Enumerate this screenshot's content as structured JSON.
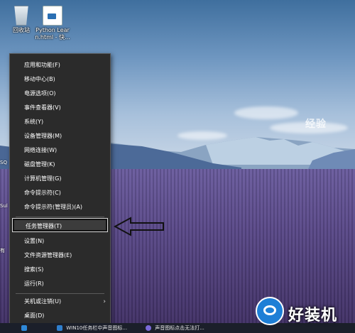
{
  "desktop": {
    "icons": [
      {
        "label": "回收站",
        "icon": "recycle-bin-icon"
      },
      {
        "label": "Python Lear n.html - 快...",
        "icon": "html-document-icon"
      }
    ],
    "left_edge_labels": [
      "SQ",
      "Sul",
      "有"
    ]
  },
  "context_menu": {
    "items": [
      {
        "label": "应用和功能(F)"
      },
      {
        "label": "移动中心(B)"
      },
      {
        "label": "电源选项(O)"
      },
      {
        "label": "事件查看器(V)"
      },
      {
        "label": "系统(Y)"
      },
      {
        "label": "设备管理器(M)"
      },
      {
        "label": "网络连接(W)"
      },
      {
        "label": "磁盘管理(K)"
      },
      {
        "label": "计算机管理(G)"
      },
      {
        "label": "命令提示符(C)"
      },
      {
        "label": "命令提示符(管理员)(A)"
      },
      {
        "label": "任务管理器(T)",
        "highlighted": true
      },
      {
        "label": "设置(N)"
      },
      {
        "label": "文件资源管理器(E)"
      },
      {
        "label": "搜索(S)"
      },
      {
        "label": "运行(R)"
      },
      {
        "label": "关机或注销(U)",
        "submenu": true
      },
      {
        "label": "桌面(D)"
      }
    ],
    "submenu_chevron": "›"
  },
  "annotation": {
    "arrow_icon": "pointer-arrow-icon",
    "color": "#111111"
  },
  "taskbar": {
    "items": [
      {
        "label": "WIN10任务栏中声音图标..."
      },
      {
        "label": "声音图标点击无法打..."
      }
    ]
  },
  "watermark": {
    "text": "好装机",
    "faint_text": "经验"
  }
}
